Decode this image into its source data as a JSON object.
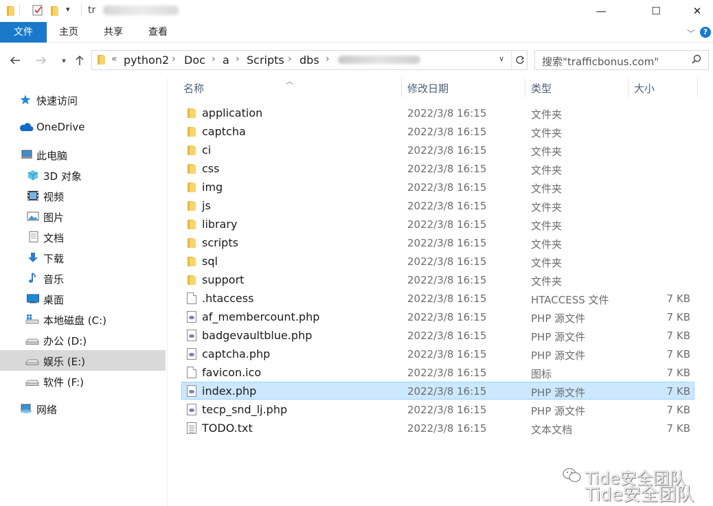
{
  "titlebar": {
    "title_prefix": "tr",
    "minimize": "—",
    "maximize": "☐",
    "close": "✕"
  },
  "ribbon": {
    "tabs": [
      {
        "label": "文件"
      },
      {
        "label": "主页"
      },
      {
        "label": "共享"
      },
      {
        "label": "查看"
      }
    ],
    "help": "?"
  },
  "address": {
    "overflow": "«",
    "crumbs": [
      "python2",
      "Doc",
      "a",
      "Scripts",
      "dbs"
    ]
  },
  "search": {
    "placeholder": "搜索\"trafficbonus.com\""
  },
  "nav": {
    "items": [
      {
        "label": "快速访问",
        "icon": "star-icon"
      },
      {
        "label": "OneDrive",
        "icon": "cloud-icon"
      },
      {
        "label": "此电脑",
        "icon": "computer-icon"
      },
      {
        "label": "3D 对象",
        "icon": "cube-icon"
      },
      {
        "label": "视频",
        "icon": "video-icon"
      },
      {
        "label": "图片",
        "icon": "picture-icon"
      },
      {
        "label": "文档",
        "icon": "document-icon"
      },
      {
        "label": "下载",
        "icon": "download-icon"
      },
      {
        "label": "音乐",
        "icon": "music-icon"
      },
      {
        "label": "桌面",
        "icon": "desktop-icon"
      },
      {
        "label": "本地磁盘 (C:)",
        "icon": "windows-drive-icon"
      },
      {
        "label": "办公 (D:)",
        "icon": "drive-icon"
      },
      {
        "label": "娱乐 (E:)",
        "icon": "drive-icon"
      },
      {
        "label": "软件 (F:)",
        "icon": "drive-icon"
      },
      {
        "label": "网络",
        "icon": "network-icon"
      }
    ]
  },
  "columns": {
    "name": "名称",
    "date": "修改日期",
    "type": "类型",
    "size": "大小"
  },
  "files": [
    {
      "name": "application",
      "date": "2022/3/8 16:15",
      "type": "文件夹",
      "size": "",
      "icon": "folder-icon"
    },
    {
      "name": "captcha",
      "date": "2022/3/8 16:15",
      "type": "文件夹",
      "size": "",
      "icon": "folder-icon"
    },
    {
      "name": "ci",
      "date": "2022/3/8 16:15",
      "type": "文件夹",
      "size": "",
      "icon": "folder-icon"
    },
    {
      "name": "css",
      "date": "2022/3/8 16:15",
      "type": "文件夹",
      "size": "",
      "icon": "folder-icon"
    },
    {
      "name": "img",
      "date": "2022/3/8 16:15",
      "type": "文件夹",
      "size": "",
      "icon": "folder-icon"
    },
    {
      "name": "js",
      "date": "2022/3/8 16:15",
      "type": "文件夹",
      "size": "",
      "icon": "folder-icon"
    },
    {
      "name": "library",
      "date": "2022/3/8 16:15",
      "type": "文件夹",
      "size": "",
      "icon": "folder-icon"
    },
    {
      "name": "scripts",
      "date": "2022/3/8 16:15",
      "type": "文件夹",
      "size": "",
      "icon": "folder-icon"
    },
    {
      "name": "sql",
      "date": "2022/3/8 16:15",
      "type": "文件夹",
      "size": "",
      "icon": "folder-icon"
    },
    {
      "name": "support",
      "date": "2022/3/8 16:15",
      "type": "文件夹",
      "size": "",
      "icon": "folder-icon"
    },
    {
      "name": ".htaccess",
      "date": "2022/3/8 16:15",
      "type": "HTACCESS 文件",
      "size": "7 KB",
      "icon": "file-icon"
    },
    {
      "name": "af_membercount.php",
      "date": "2022/3/8 16:15",
      "type": "PHP 源文件",
      "size": "7 KB",
      "icon": "php-file-icon"
    },
    {
      "name": "badgevaultblue.php",
      "date": "2022/3/8 16:15",
      "type": "PHP 源文件",
      "size": "7 KB",
      "icon": "php-file-icon"
    },
    {
      "name": "captcha.php",
      "date": "2022/3/8 16:15",
      "type": "PHP 源文件",
      "size": "7 KB",
      "icon": "php-file-icon"
    },
    {
      "name": "favicon.ico",
      "date": "2022/3/8 16:15",
      "type": "图标",
      "size": "7 KB",
      "icon": "file-icon"
    },
    {
      "name": "index.php",
      "date": "2022/3/8 16:15",
      "type": "PHP 源文件",
      "size": "7 KB",
      "icon": "php-file-icon",
      "selected": true
    },
    {
      "name": "tecp_snd_lj.php",
      "date": "2022/3/8 16:15",
      "type": "PHP 源文件",
      "size": "7 KB",
      "icon": "php-file-icon"
    },
    {
      "name": "TODO.txt",
      "date": "2022/3/8 16:15",
      "type": "文本文档",
      "size": "7 KB",
      "icon": "text-file-icon"
    }
  ],
  "watermark": "Tide安全团队",
  "colors": {
    "accent": "#1979ca",
    "selected_row": "#cce8ff",
    "selected_border": "#99d1ff",
    "folder": "#f8d46c"
  }
}
